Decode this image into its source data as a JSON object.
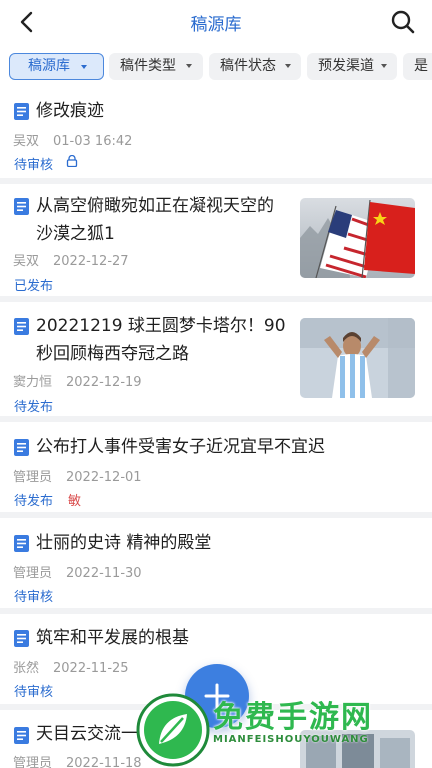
{
  "header": {
    "title": "稿源库"
  },
  "filters": [
    {
      "label": "稿源库",
      "active": true
    },
    {
      "label": "稿件类型",
      "active": false
    },
    {
      "label": "稿件状态",
      "active": false
    },
    {
      "label": "预发渠道",
      "active": false
    },
    {
      "label": "是",
      "active": false
    }
  ],
  "items": [
    {
      "title": "修改痕迹",
      "author": "吴双",
      "date": "01-03 16:42",
      "status": "待审核",
      "badge": "",
      "locked": true,
      "thumbnail": ""
    },
    {
      "title": "从高空俯瞰宛如正在凝视天空的沙漠之狐1",
      "author": "吴双",
      "date": "2022-12-27",
      "status": "已发布",
      "badge": "",
      "locked": false,
      "thumbnail": "flags-photo"
    },
    {
      "title": "20221219 球王圆梦卡塔尔！90秒回顾梅西夺冠之路",
      "author": "窦力恒",
      "date": "2022-12-19",
      "status": "待发布",
      "badge": "",
      "locked": false,
      "thumbnail": "soccer-player-photo"
    },
    {
      "title": "公布打人事件受害女子近况宜早不宜迟",
      "author": "管理员",
      "date": "2022-12-01",
      "status": "待发布",
      "badge": "敏",
      "locked": false,
      "thumbnail": ""
    },
    {
      "title": "壮丽的史诗 精神的殿堂",
      "author": "管理员",
      "date": "2022-11-30",
      "status": "待审核",
      "badge": "",
      "locked": false,
      "thumbnail": ""
    },
    {
      "title": "筑牢和平发展的根基",
      "author": "张然",
      "date": "2022-11-25",
      "status": "待审核",
      "badge": "",
      "locked": false,
      "thumbnail": ""
    },
    {
      "title": "天目云交流一休养",
      "author": "管理员",
      "date": "2022-11-18",
      "status": "",
      "badge": "",
      "locked": false,
      "thumbnail": "partial-photo"
    }
  ],
  "watermark": {
    "main": "免费手游网",
    "sub": "MIANFEISHOUYOUWANG"
  },
  "colors": {
    "accent": "#2b6ccf",
    "badge": "#d94a4a",
    "watermark": "#2fb84f"
  }
}
